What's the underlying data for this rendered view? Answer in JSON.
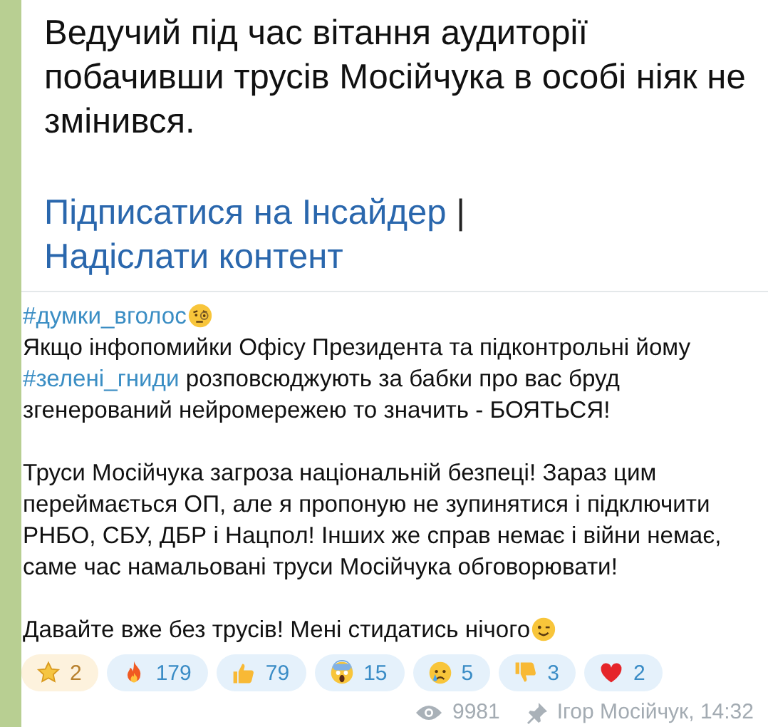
{
  "quoted_image": {
    "text": "Ведучий під час вітання аудиторії побачивши трусів Мосійчука в особі ніяк не змінився.",
    "links": [
      {
        "kind": "link",
        "text": "Підписатися на Інсайдер"
      },
      {
        "kind": "separator",
        "text": "|"
      },
      {
        "kind": "link",
        "text": "Надіслати контент"
      }
    ]
  },
  "message": {
    "paragraphs": [
      [
        {
          "kind": "hashtag",
          "text": "#думки_вголос"
        },
        {
          "kind": "monocle_emoji"
        },
        {
          "kind": "break"
        },
        {
          "kind": "text",
          "text": "Якщо інфопомийки Офісу Президента та підконтрольні йому "
        },
        {
          "kind": "hashtag",
          "text": "#зелені_гниди"
        },
        {
          "kind": "text",
          "text": " розповсюджують за бабки про вас бруд згенерований нейромережею то значить - БОЯТЬСЯ!"
        }
      ],
      [
        {
          "kind": "text",
          "text": "Труси Мосійчука загроза національній безпеці! Зараз цим переймається ОП, але я пропоную не зупинятися і підключити РНБО, СБУ, ДБР і Нацпол! Інших же справ немає і війни немає, саме час намальовані труси Мосійчука обговорювати!"
        }
      ],
      [
        {
          "kind": "text",
          "text": "Давайте вже без трусів! Мені стидатись нічого"
        },
        {
          "kind": "wink_emoji"
        }
      ]
    ]
  },
  "reactions": [
    {
      "kind": "star",
      "count": "2"
    },
    {
      "kind": "fire",
      "count": "179"
    },
    {
      "kind": "thumbs_up",
      "count": "79"
    },
    {
      "kind": "scream",
      "count": "15"
    },
    {
      "kind": "cry",
      "count": "5"
    },
    {
      "kind": "thumbs_down",
      "count": "3"
    },
    {
      "kind": "heart",
      "count": "2"
    }
  ],
  "footer": {
    "views": "9981",
    "signature": "Ігор Мосійчук, 14:32"
  }
}
